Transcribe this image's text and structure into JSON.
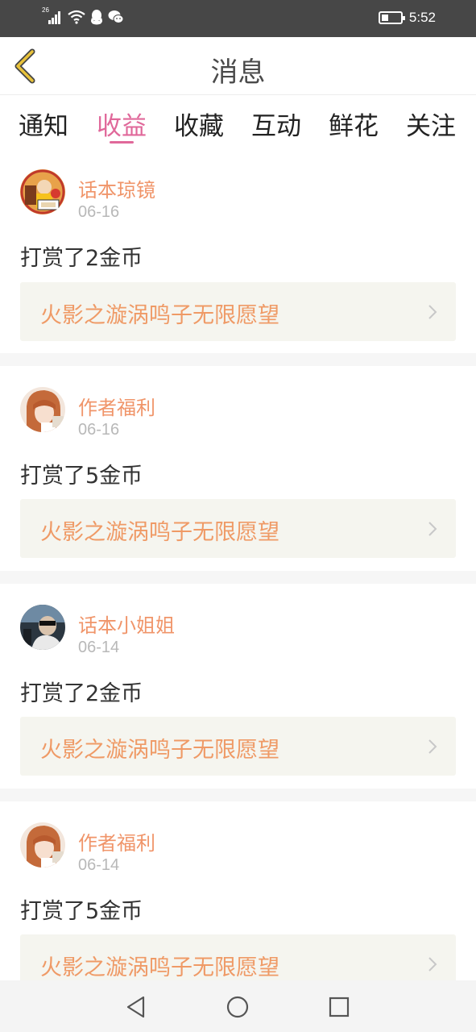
{
  "status_bar": {
    "network": "26",
    "time": "5:52",
    "battery_level": 0.35,
    "icons": [
      "signal-icon",
      "wifi-icon",
      "qq-icon",
      "wechat-icon",
      "battery-icon"
    ]
  },
  "header": {
    "title": "消息",
    "back_icon": "chevron-left-icon"
  },
  "tabs": [
    {
      "label": "通知"
    },
    {
      "label": "收益"
    },
    {
      "label": "收藏"
    },
    {
      "label": "互动"
    },
    {
      "label": "鲜花"
    },
    {
      "label": "关注"
    }
  ],
  "active_tab": "收益",
  "messages": [
    {
      "name": "话本琼镜",
      "date": "06-16",
      "action": "打赏了2金币",
      "book": "火影之漩涡鸣子无限愿望"
    },
    {
      "name": "作者福利",
      "date": "06-16",
      "action": "打赏了5金币",
      "book": "火影之漩涡鸣子无限愿望"
    },
    {
      "name": "话本小姐姐",
      "date": "06-14",
      "action": "打赏了2金币",
      "book": "火影之漩涡鸣子无限愿望"
    },
    {
      "name": "作者福利",
      "date": "06-14",
      "action": "打赏了5金币",
      "book": "火影之漩涡鸣子无限愿望"
    }
  ],
  "colors": {
    "accent": "#e0689a",
    "name_color": "#f0956a",
    "book_title_color": "#ef9a66",
    "back_icon_color": "#e8c23a"
  },
  "nav_bar": [
    "back-triangle-icon",
    "home-circle-icon",
    "recents-square-icon"
  ]
}
